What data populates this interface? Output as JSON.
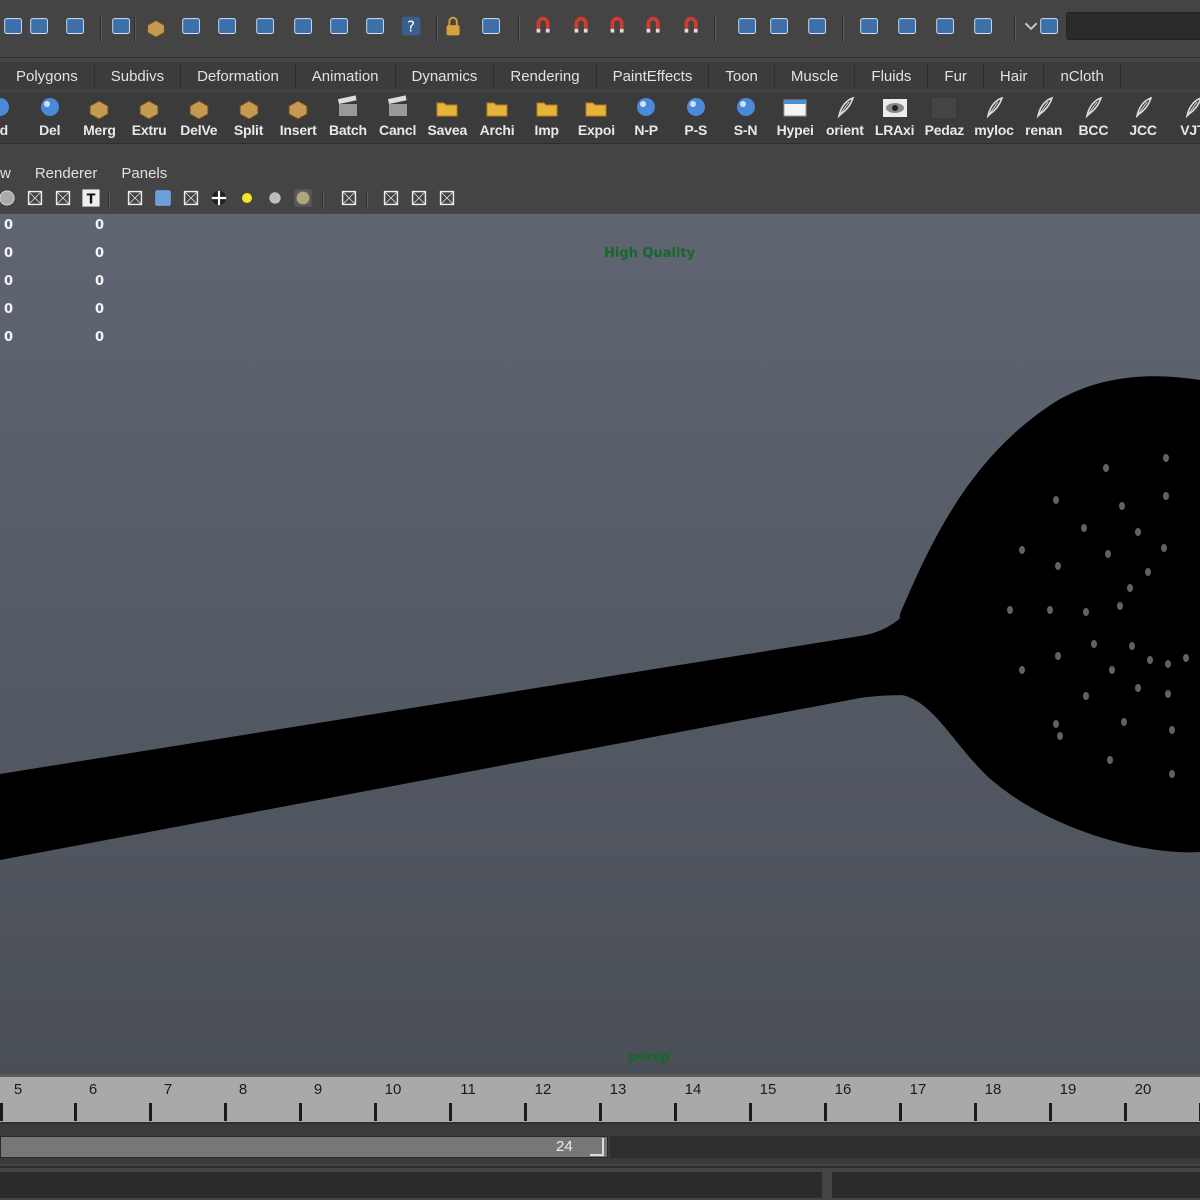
{
  "toolbar": {
    "tools": [
      {
        "icon": "select-by-hierarchy-icon",
        "name": "tool-select-hierarchy"
      },
      {
        "icon": "select-by-object-icon",
        "name": "tool-select-object"
      },
      {
        "icon": "select-by-component-icon",
        "name": "tool-select-component"
      },
      {
        "icon": "select-filter-icon",
        "name": "tool-select-filter"
      },
      {
        "icon": "snap-to-grid-plus-icon",
        "name": "tool-snap-point"
      },
      {
        "icon": "curve-point-icon",
        "name": "tool-curve-point"
      },
      {
        "icon": "curve-icon",
        "name": "tool-curve"
      },
      {
        "icon": "surface-icon",
        "name": "tool-surface"
      },
      {
        "icon": "lattice-icon",
        "name": "tool-lattice"
      },
      {
        "icon": "particle-icon",
        "name": "tool-particle"
      },
      {
        "icon": "paint-icon",
        "name": "tool-paint"
      },
      {
        "icon": "help-question-icon",
        "name": "tool-help"
      },
      {
        "icon": "lock-icon",
        "name": "tool-lock"
      },
      {
        "icon": "select-highlight-icon",
        "name": "tool-select-highlight"
      },
      {
        "icon": "magnet-grid-icon",
        "name": "tool-snap-grid"
      },
      {
        "icon": "magnet-curve-icon",
        "name": "tool-snap-curve"
      },
      {
        "icon": "magnet-point-icon",
        "name": "tool-snap-point-magnet"
      },
      {
        "icon": "magnet-plane-icon",
        "name": "tool-snap-plane"
      },
      {
        "icon": "magnet-live-icon",
        "name": "tool-snap-live"
      },
      {
        "icon": "input-ops-icon",
        "name": "tool-input-ops"
      },
      {
        "icon": "output-ops-icon",
        "name": "tool-output-ops"
      },
      {
        "icon": "construction-history-icon",
        "name": "tool-history"
      },
      {
        "icon": "render-frame-icon",
        "name": "tool-render-frame"
      },
      {
        "icon": "ipr-render-icon",
        "name": "tool-ipr-render"
      },
      {
        "icon": "render-settings-icon",
        "name": "tool-render-settings"
      },
      {
        "icon": "hypershade-icon",
        "name": "tool-hypershade"
      },
      {
        "icon": "chevron-down-icon",
        "name": "tool-filter-dropdown"
      },
      {
        "icon": "quick-select-icon",
        "name": "tool-quick-select"
      }
    ]
  },
  "shelf_tabs": [
    "Polygons",
    "Subdivs",
    "Deformation",
    "Animation",
    "Dynamics",
    "Rendering",
    "PaintEffects",
    "Toon",
    "Muscle",
    "Fluids",
    "Fur",
    "Hair",
    "nCloth"
  ],
  "shelf": {
    "buttons": [
      {
        "label": "ed",
        "icon": "green-sphere-icon"
      },
      {
        "label": "Del",
        "icon": "blue-sphere-icon"
      },
      {
        "label": "Merg",
        "icon": "merge-grid-icon"
      },
      {
        "label": "Extru",
        "icon": "extrude-box-icon"
      },
      {
        "label": "DelVe",
        "icon": "delete-vertex-icon"
      },
      {
        "label": "Split",
        "icon": "split-poly-icon"
      },
      {
        "label": "Insert",
        "icon": "insert-edge-loop-icon"
      },
      {
        "label": "Batch",
        "icon": "clapboard-icon"
      },
      {
        "label": "Cancl",
        "icon": "clapboard-icon"
      },
      {
        "label": "Savea",
        "icon": "folder-icon"
      },
      {
        "label": "Archi",
        "icon": "folder-icon"
      },
      {
        "label": "Imp",
        "icon": "folder-icon"
      },
      {
        "label": "Expoi",
        "icon": "folder-icon"
      },
      {
        "label": "N-P",
        "icon": "sphere-convert-icon"
      },
      {
        "label": "P-S",
        "icon": "poly-to-subdiv-icon"
      },
      {
        "label": "S-N",
        "icon": "subdiv-to-nurbs-icon"
      },
      {
        "label": "Hypei",
        "icon": "window-icon"
      },
      {
        "label": "orient",
        "icon": "script-feather-icon"
      },
      {
        "label": "LRAxi",
        "icon": "eye-icon"
      },
      {
        "label": "Pedaz",
        "icon": "blank-icon"
      },
      {
        "label": "myloc",
        "icon": "script-feather-icon"
      },
      {
        "label": "renan",
        "icon": "script-feather-icon"
      },
      {
        "label": "BCC",
        "icon": "script-feather-icon"
      },
      {
        "label": "JCC",
        "icon": "script-feather-icon"
      },
      {
        "label": "VJT",
        "icon": "script-feather-icon"
      }
    ]
  },
  "panel_menu": [
    "w",
    "Renderer",
    "Panels"
  ],
  "panel_toolbar": [
    {
      "icon": "circle-shade-icon",
      "name": "panel-btn-smooth"
    },
    {
      "icon": "xray-grid-icon",
      "name": "panel-btn-xray"
    },
    {
      "icon": "uv-texture-icon",
      "name": "panel-btn-uv"
    },
    {
      "icon": "text-t-icon",
      "name": "panel-btn-text"
    },
    {
      "icon": "wireframe-cube-icon",
      "name": "panel-btn-wireframe"
    },
    {
      "icon": "smooth-shade-cube-icon",
      "name": "panel-btn-shaded"
    },
    {
      "icon": "wireframe-on-shaded-icon",
      "name": "panel-btn-wire-on-shaded"
    },
    {
      "icon": "checker-texture-icon",
      "name": "panel-btn-textured"
    },
    {
      "icon": "default-light-icon",
      "name": "panel-btn-light"
    },
    {
      "icon": "grey-sphere-icon",
      "name": "panel-btn-all-lights"
    },
    {
      "icon": "shadow-sphere-icon",
      "name": "panel-btn-shadows"
    },
    {
      "icon": "isolate-select-icon",
      "name": "panel-btn-isolate"
    },
    {
      "icon": "backface-cube-icon",
      "name": "panel-btn-backface"
    },
    {
      "icon": "xray-joints-icon",
      "name": "panel-btn-xray-joints"
    },
    {
      "icon": "share-nodes-icon",
      "name": "panel-btn-share"
    }
  ],
  "viewport": {
    "hud_rows": [
      [
        "0",
        "0"
      ],
      [
        "0",
        "0"
      ],
      [
        "0",
        "0"
      ],
      [
        "0",
        "0"
      ],
      [
        "0",
        "0"
      ]
    ],
    "quality_label": "High Quality",
    "camera_label": "persp",
    "bg_top": "#5f6672",
    "bg_bottom": "#4a4f57",
    "model_color": "#000000"
  },
  "time_slider": {
    "ticks": [
      "5",
      "6",
      "7",
      "8",
      "9",
      "10",
      "11",
      "12",
      "13",
      "14",
      "15",
      "16",
      "17",
      "18",
      "19",
      "20"
    ]
  },
  "range_slider": {
    "end_value": "24"
  }
}
